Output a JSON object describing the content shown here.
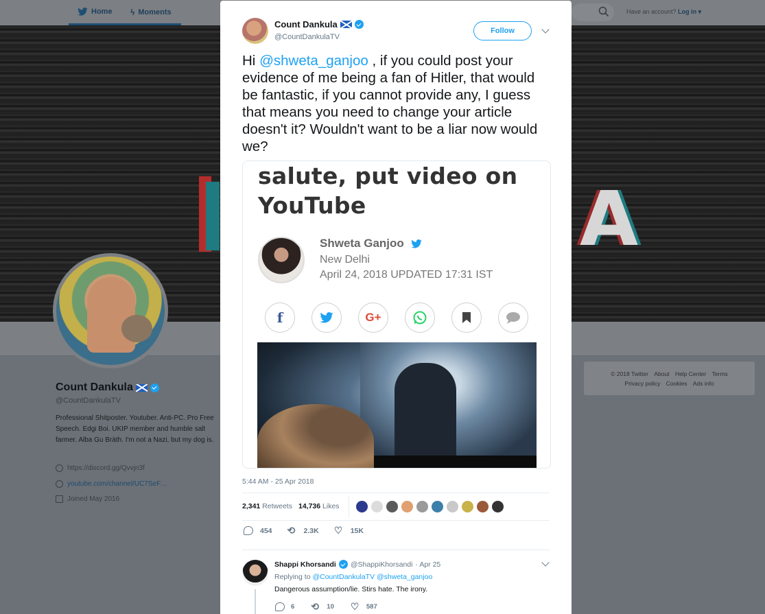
{
  "nav": {
    "home": "Home",
    "moments": "Moments",
    "account_prompt": "Have an account?",
    "login": "Log in"
  },
  "profile": {
    "name": "Count Dankula",
    "handle": "@CountDankulaTV",
    "bio": "Professional Shitposter. Youtuber. Anti-PC. Pro Free Speech. Edgi Boi. UKIP member and humble salt farmer. Alba Gu Bràth. I'm not a Nazi, but my dog is.",
    "link1": "https://discord.gg/Qvvjn3f",
    "link2": "youtube.com/channel/UC7SeF…",
    "joined": "Joined May 2016"
  },
  "footer": {
    "copyright": "© 2018 Twitter",
    "about": "About",
    "help": "Help Center",
    "terms": "Terms",
    "privacy": "Privacy policy",
    "cookies": "Cookies",
    "ads": "Ads info"
  },
  "tweet": {
    "author_name": "Count Dankula",
    "author_handle": "@CountDankulaTV",
    "follow_label": "Follow",
    "text_prefix": "Hi ",
    "mention": "@shweta_ganjoo",
    "text_body": " , if you could post your evidence of me being a fan of Hitler, that would be fantastic, if you cannot provide any, I guess that means you need to change your article doesn't it? Wouldn't want to be a liar now would we?",
    "timestamp": "5:44 AM - 25 Apr 2018",
    "retweets_count": "2,341",
    "retweets_label": "Retweets",
    "likes_count": "14,736",
    "likes_label": "Likes",
    "reply_count": "454",
    "retweet_count_short": "2.3K",
    "like_count_short": "15K"
  },
  "media": {
    "headline": "salute, put video on YouTube",
    "author": "Shweta Ganjoo",
    "location": "New Delhi",
    "date": "April 24, 2018",
    "updated": "UPDATED 17:31 IST",
    "share_icons": [
      "facebook-icon",
      "twitter-icon",
      "google-plus-icon",
      "whatsapp-icon",
      "bookmark-icon",
      "comment-icon"
    ]
  },
  "likers": [
    "#2b3a8f",
    "#dcdcdc",
    "#5b5b5b",
    "#e0a070",
    "#9a9a9a",
    "#3c7fa8",
    "#c9c9c9",
    "#c8b24a",
    "#9a5a3a",
    "#333333"
  ],
  "reply": {
    "name": "Shappi Khorsandi",
    "handle": "@ShappiKhorsandi",
    "date": "· Apr 25",
    "replying_prefix": "Replying to",
    "replying_to": "@CountDankulaTV @shweta_ganjoo",
    "text": "Dangerous assumption/lie. Stirs hate. The irony.",
    "reply_count": "6",
    "retweet_count": "10",
    "like_count": "587"
  },
  "colors": {
    "accent": "#1da1f2",
    "overlay": "#6c7177"
  }
}
